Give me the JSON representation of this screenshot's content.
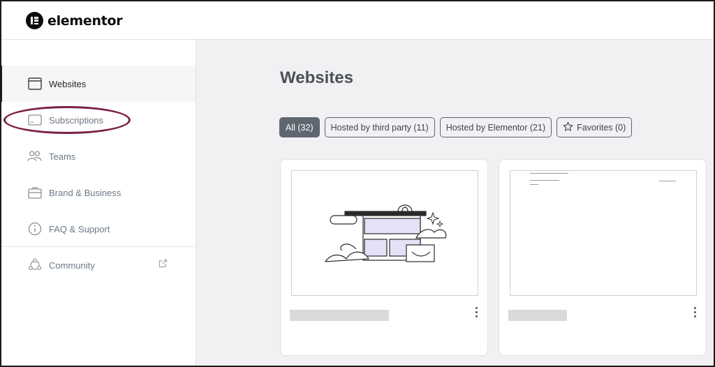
{
  "brand": {
    "name": "elementor",
    "logo_icon": "elementor-logo-icon"
  },
  "sidebar": {
    "items": [
      {
        "label": "Websites",
        "icon": "browser-window-icon",
        "active": true
      },
      {
        "label": "Subscriptions",
        "icon": "credit-card-icon",
        "active": false
      },
      {
        "label": "Teams",
        "icon": "people-icon",
        "active": false
      },
      {
        "label": "Brand & Business",
        "icon": "briefcase-icon",
        "active": false
      },
      {
        "label": "FAQ & Support",
        "icon": "info-circle-icon",
        "active": false
      },
      {
        "label": "Community",
        "icon": "community-icon",
        "external_icon": "external-link-icon",
        "active": false
      }
    ],
    "highlighted_item": "Subscriptions",
    "highlight_color": "#7b1e46"
  },
  "main": {
    "title": "Websites",
    "filters": [
      {
        "label": "All (32)",
        "active": true
      },
      {
        "label": "Hosted by third party (11)",
        "active": false
      },
      {
        "label": "Hosted by Elementor (21)",
        "active": false
      },
      {
        "label": "Favorites (0)",
        "active": false,
        "icon": "star-icon"
      }
    ],
    "cards": [
      {
        "thumbnail": "website-illustration",
        "menu_icon": "kebab-menu-icon"
      },
      {
        "thumbnail": "blank-page-preview",
        "menu_icon": "kebab-menu-icon"
      }
    ]
  },
  "colors": {
    "active_chip": "#5f6670",
    "main_bg": "#f1f1f3",
    "active_nav_bar": "#1f2124"
  }
}
